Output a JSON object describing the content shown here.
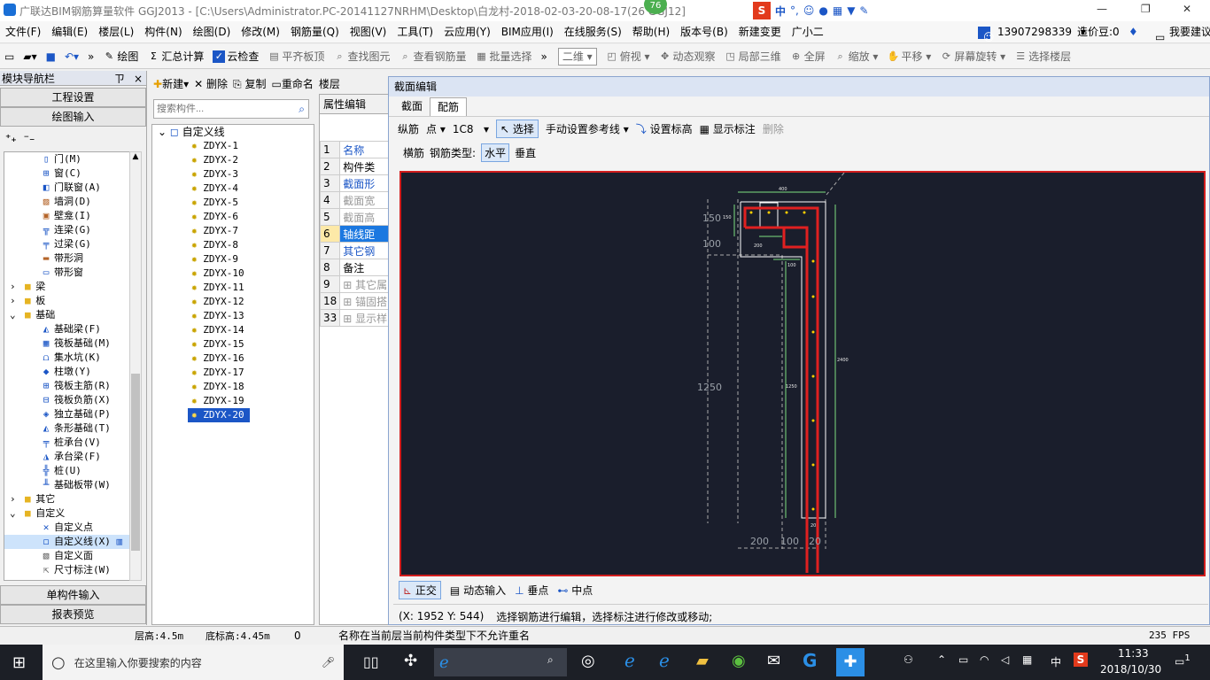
{
  "titlebar": {
    "title": "广联达BIM钢筋算量软件 GGJ2013 - [C:\\Users\\Administrator.PC-20141127NRHM\\Desktop\\白龙村-2018-02-03-20-08-17(26  GGJ12]",
    "badge": "76",
    "sogou_text": "中",
    "minimize": "—",
    "restore": "❐",
    "close": "✕"
  },
  "menubar": {
    "items": [
      "文件(F)",
      "编辑(E)",
      "楼层(L)",
      "构件(N)",
      "绘图(D)",
      "修改(M)",
      "钢筋量(Q)",
      "视图(V)",
      "工具(T)",
      "云应用(Y)",
      "BIM应用(I)",
      "在线服务(S)",
      "帮助(H)",
      "版本号(B)",
      "新建变更",
      "广小二"
    ],
    "phone": "13907298339",
    "cost": "造价豆:0",
    "suggest": "我要建议"
  },
  "toolbar": {
    "items": [
      "绘图",
      "汇总计算",
      "云检查",
      "平齐板顶",
      "查找图元",
      "查看钢筋量",
      "批量选择"
    ],
    "view_mode": "二维",
    "view_items": [
      "俯视",
      "动态观察",
      "局部三维",
      "全屏",
      "缩放",
      "平移",
      "屏幕旋转",
      "选择楼层"
    ]
  },
  "nav": {
    "title": "模块导航栏",
    "pin": "ㄗ",
    "close": "×",
    "project_settings": "工程设置",
    "drawing_input": "绘图输入",
    "single_input": "单构件输入",
    "report": "报表预览",
    "items": [
      "门(M)",
      "窗(C)",
      "门联窗(A)",
      "墙洞(D)",
      "壁龛(I)",
      "连梁(G)",
      "过梁(G)",
      "带形洞",
      "带形窗",
      "梁",
      "板",
      "基础",
      "基础梁(F)",
      "筏板基础(M)",
      "集水坑(K)",
      "柱墩(Y)",
      "筏板主筋(R)",
      "筏板负筋(X)",
      "独立基础(P)",
      "条形基础(T)",
      "桩承台(V)",
      "承台梁(F)",
      "桩(U)",
      "基础板带(W)",
      "其它",
      "自定义",
      "自定义点",
      "自定义线(X)",
      "自定义面",
      "尺寸标注(W)"
    ]
  },
  "comp": {
    "new": "新建",
    "delete": "删除",
    "copy": "复制",
    "rename": "重命名",
    "floor": "楼层",
    "search_placeholder": "搜索构件...",
    "root": "自定义线",
    "items": [
      "ZDYX-1",
      "ZDYX-2",
      "ZDYX-3",
      "ZDYX-4",
      "ZDYX-5",
      "ZDYX-6",
      "ZDYX-7",
      "ZDYX-8",
      "ZDYX-9",
      "ZDYX-10",
      "ZDYX-11",
      "ZDYX-12",
      "ZDYX-13",
      "ZDYX-14",
      "ZDYX-15",
      "ZDYX-16",
      "ZDYX-17",
      "ZDYX-18",
      "ZDYX-19",
      "ZDYX-20"
    ]
  },
  "props": {
    "tab": "属性编辑",
    "rows": [
      [
        "1",
        "名称"
      ],
      [
        "2",
        "构件类"
      ],
      [
        "3",
        "截面形"
      ],
      [
        "4",
        "截面宽"
      ],
      [
        "5",
        "截面高"
      ],
      [
        "6",
        "轴线距"
      ],
      [
        "7",
        "其它钢"
      ],
      [
        "8",
        "备注"
      ],
      [
        "9",
        "其它属"
      ],
      [
        "18",
        "锚固搭"
      ],
      [
        "33",
        "显示样"
      ]
    ]
  },
  "section": {
    "title": "截面编辑",
    "tabs": [
      "截面",
      "配筋"
    ],
    "zongjin": "纵筋",
    "point": "点",
    "bar": "1C8",
    "select": "选择",
    "manual_ref": "手动设置参考线",
    "set_elev": "设置标高",
    "show_label": "显示标注",
    "delete": "删除",
    "hengjin": "横筋",
    "rebar_type": "钢筋类型:",
    "horizontal": "水平",
    "vertical": "垂直"
  },
  "drawing": {
    "dims": [
      "150",
      "100",
      "1250",
      "200",
      "100",
      "20",
      "400",
      "150",
      "200",
      "100",
      "2400",
      "1250",
      "20"
    ]
  },
  "bottom_tools": {
    "ortho": "正交",
    "dynamic": "动态输入",
    "perp": "垂点",
    "mid": "中点"
  },
  "coord": {
    "text": "(X: 1952 Y: 544)",
    "hint": "选择钢筋进行编辑，选择标注进行修改或移动;"
  },
  "status": {
    "floor_h": "层高:4.5m",
    "base_h": "底标高:4.45m",
    "zero": "0",
    "msg": "名称在当前层当前构件类型下不允许重名",
    "fps": "235 FPS"
  },
  "taskbar": {
    "search": "在这里输入你要搜索的内容",
    "ime": "中",
    "time": "11:33",
    "date": "2018/10/30",
    "notif": "1"
  }
}
